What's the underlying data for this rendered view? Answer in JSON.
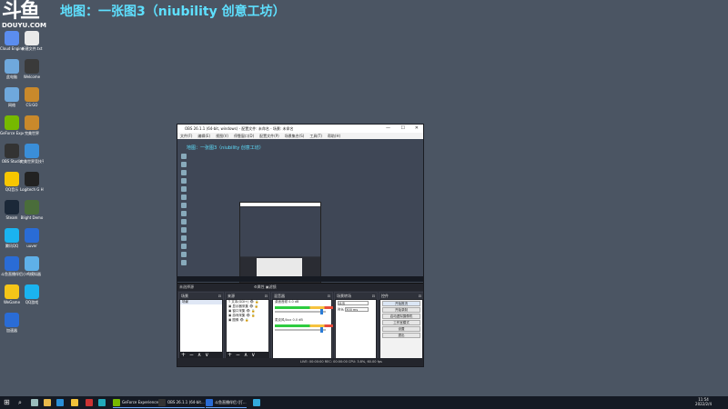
{
  "stream": {
    "logo_text": "DOUYU.COM",
    "title": "地图：一张图3（niubility 创意工坊）"
  },
  "desktop_icons": [
    {
      "label": "Cloud Engine",
      "color": "#5b8def"
    },
    {
      "label": "新建文件.txt",
      "color": "#e9e9e9"
    },
    {
      "label": "此电脑",
      "color": "#6fa8dc"
    },
    {
      "label": "Welcome",
      "color": "#3a3a3a"
    },
    {
      "label": "网络",
      "color": "#6fa8dc"
    },
    {
      "label": "CS:GO",
      "color": "#c9892b"
    },
    {
      "label": "GeForce Experience",
      "color": "#76b900"
    },
    {
      "label": "完美世界",
      "color": "#c9892b"
    },
    {
      "label": "OBS Studio",
      "color": "#333333"
    },
    {
      "label": "完美世界竞技平台",
      "color": "#3a8ed8"
    },
    {
      "label": "QQ音乐",
      "color": "#f7c600"
    },
    {
      "label": "Logitech G HUB",
      "color": "#222222"
    },
    {
      "label": "Steam",
      "color": "#1b2838"
    },
    {
      "label": "Blight Demo",
      "color": "#4a6d3a"
    },
    {
      "label": "腾讯QQ",
      "color": "#1ab3f0"
    },
    {
      "label": "uuver",
      "color": "#2a6cd6"
    },
    {
      "label": "斗鱼直播伴侣",
      "color": "#2a6cd6"
    },
    {
      "label": "小鸡模拟器",
      "color": "#5fb0e8"
    },
    {
      "label": "WeGame",
      "color": "#f5c518"
    },
    {
      "label": "QQ游戏",
      "color": "#1ab3f0"
    },
    {
      "label": "加速器",
      "color": "#2a6cd6"
    }
  ],
  "obs": {
    "title": "OBS 26.1.1 (64-bit, windows) - 配置文件: 未命名 - 场景: 未命名",
    "menu": [
      "文件(F)",
      "编辑(E)",
      "视图(V)",
      "停靠窗口(D)",
      "配置文件(P)",
      "场景集合(S)",
      "工具(T)",
      "帮助(H)"
    ],
    "preview_title": "地图：一张图3（niubility 创意工坊）",
    "strip_left": "未选择源",
    "strip_mid": "⚙属性   ▣滤镜",
    "scenes": {
      "header": "场景",
      "items": [
        "场景"
      ]
    },
    "sources": {
      "header": "来源",
      "items": [
        "T 文本(GDI+)",
        "▣ 显示器采集",
        "▣ 窗口采集",
        "▣ 游戏采集",
        "▣ 图像"
      ]
    },
    "mixer": {
      "header": "混音器",
      "channels": [
        {
          "name": "桌面音频",
          "level": "0.0 dB"
        },
        {
          "name": "麦克风/Aux",
          "level": "0.0 dB"
        }
      ]
    },
    "transitions": {
      "header": "场景转场",
      "type": "淡出",
      "duration_label": "时长",
      "duration": "300 ms"
    },
    "controls": {
      "header": "控件",
      "buttons": [
        "开始推流",
        "开始录制",
        "启动虚拟摄像机",
        "工作室模式",
        "设置",
        "退出"
      ]
    },
    "status": "LIVE: 00:00:00   REC: 00:00:00   CPU: 3.8%, 60.00 fps",
    "footer_symbols": "+ − ∧ ∨"
  },
  "taskbar": {
    "items": [
      {
        "label": "GeForce Experience",
        "color": "#76b900"
      },
      {
        "label": "OBS 26.1.1 (64-bit...",
        "color": "#333333"
      },
      {
        "label": "斗鱼直播伴侣 (打...",
        "color": "#2a6cd6"
      }
    ],
    "time": "11:54",
    "date": "2022/2/4"
  }
}
